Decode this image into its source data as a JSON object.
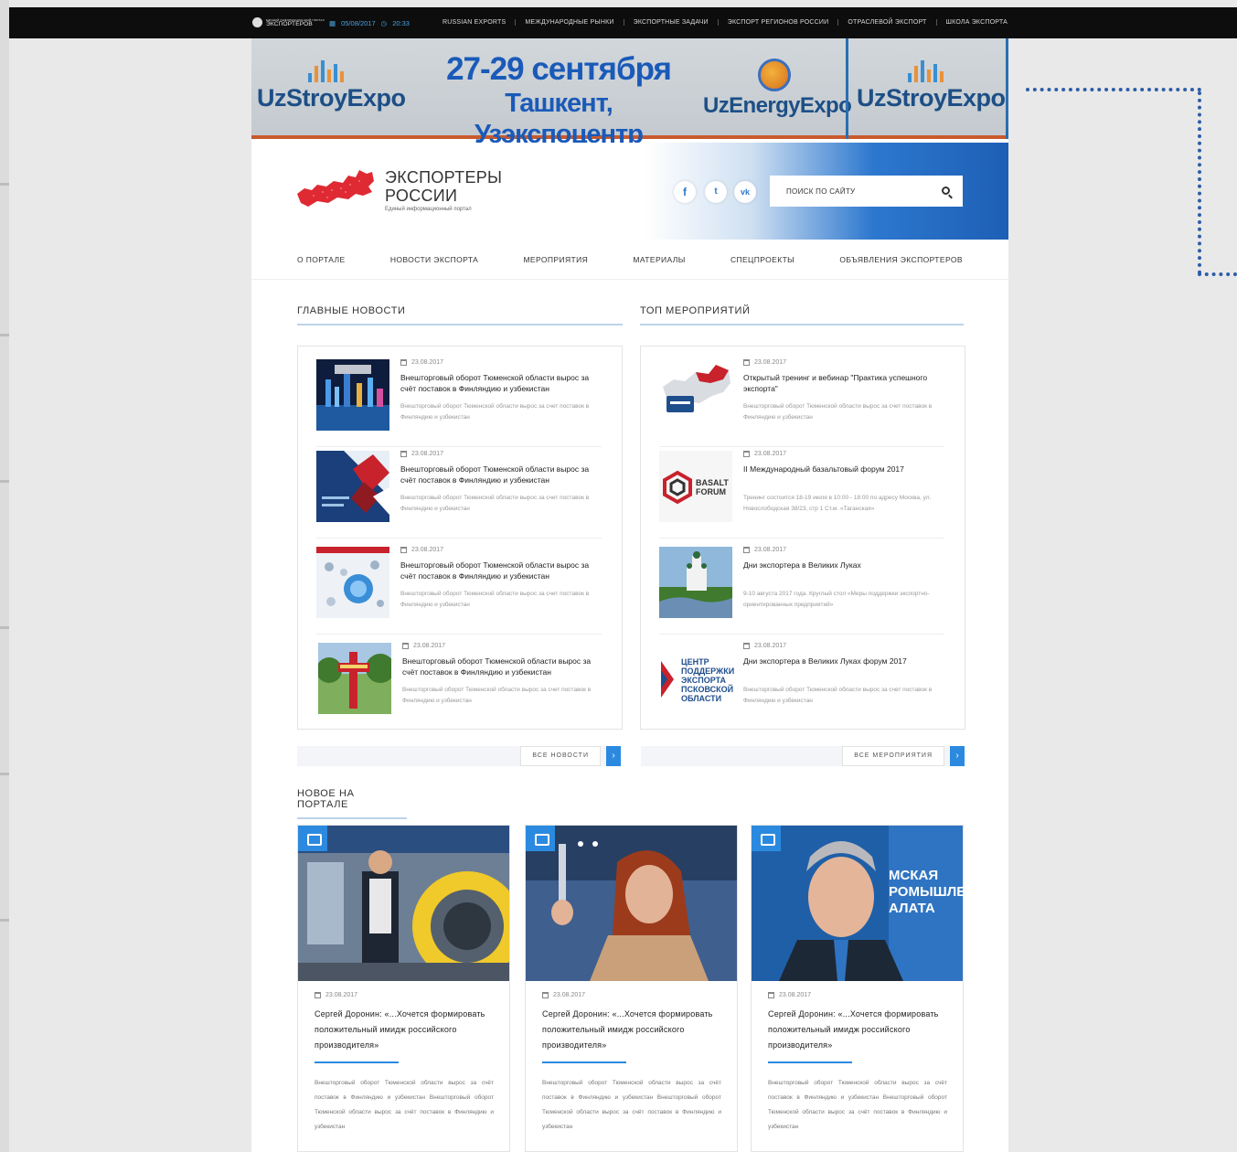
{
  "topbar": {
    "mini_logo_line1": "ЕДИНЫЙ ИНФОРМАЦИОННЫЙ ПОРТАЛ",
    "mini_logo_line2": "ЭКСПОРТЕРОВ",
    "date": "05/08/2017",
    "time": "20:33",
    "nav": [
      "RUSSIAN EXPORTS",
      "МЕЖДУНАРОДНЫЕ РЫНКИ",
      "ЭКСПОРТНЫЕ ЗАДАЧИ",
      "ЭКСПОРТ РЕГИОНОВ РОССИИ",
      "ОТРАСЛЕВОЙ ЭКСПОРТ",
      "ШКОЛА ЭКСПОРТА"
    ]
  },
  "banner": {
    "left_logo": "UzStroyExpo",
    "date_line": "27-29 сентября",
    "place_line": "Ташкент, Узэкспоцентр",
    "energy_logo": "UzEnergyExpo",
    "right_logo": "UzStroyExpo",
    "accent_color": "#1a5ab8"
  },
  "header": {
    "title_line1": "ЭКСПОРТЕРЫ",
    "title_line2": "РОССИИ",
    "subtitle": "Единый информационный портал",
    "social": [
      "f",
      "t",
      "vk"
    ],
    "search_placeholder": "ПОИСК ПО САЙТУ"
  },
  "mainnav": [
    "О ПОРТАЛЕ",
    "НОВОСТИ ЭКСПОРТА",
    "МЕРОПРИЯТИЯ",
    "МАТЕРИАЛЫ",
    "СПЕЦПРОЕКТЫ",
    "ОБЪЯВЛЕНИЯ ЭКСПОРТЕРОВ"
  ],
  "news": {
    "title": "ГЛАВНЫЕ НОВОСТИ",
    "more": "ВСЕ НОВОСТИ",
    "items": [
      {
        "date": "23.08.2017",
        "title": "Внешторговый оборот Тюменской области вырос за счёт поставок в Финляндию и узбекистан",
        "desc": "Внешторговый оборот Тюменской области вырос за счет поставок в Финляндию и узбекистан"
      },
      {
        "date": "23.08.2017",
        "title": "Внешторговый оборот Тюменской области вырос за счёт поставок в Финляндию и узбекистан",
        "desc": "Внешторговый оборот Тюменской области вырос за счет поставок в Финляндию и узбекистан"
      },
      {
        "date": "23.08.2017",
        "title": "Внешторговый оборот Тюменской области вырос за счёт поставок в Финляндию и узбекистан",
        "desc": "Внешторговый оборот Тюменской области вырос за счет поставок в Финляндию и узбекистан"
      },
      {
        "date": "23.08.2017",
        "title": "Внешторговый оборот Тюменской области вырос за счёт поставок в Финляндию и узбекистан",
        "desc": "Внешторговый оборот Тюменской области вырос за счет поставок в Финляндию и узбекистан"
      }
    ]
  },
  "events": {
    "title": "ТОП МЕРОПРИЯТИЙ",
    "more": "ВСЕ МЕРОПРИЯТИЯ",
    "items": [
      {
        "date": "23.08.2017",
        "title": "Открытый тренинг и вебинар \"Практика успешного экспорта\"",
        "desc": "Внешторговый оборот Тюменской области вырос за счет поставок в Финляндию и узбекистан"
      },
      {
        "date": "23.08.2017",
        "title": "II Международный базальтовый форум 2017",
        "desc": "Тренинг состоится 18-19 июля в 10:00 - 18:00 по адресу Москва, ул. Новослободская 38/23, стр 1 Ст.м. «Таганская»"
      },
      {
        "date": "23.08.2017",
        "title": "Дни экспортера в Великих Луках",
        "desc": "9-10 августа 2017 года. Круглый стол «Меры поддержки экспортно-ориентированных предприятий»"
      },
      {
        "date": "23.08.2017",
        "title": "Дни экспортера в Великих Лукаx форум 2017",
        "desc": "Внешторговый оборот Тюменской области вырос за счет поставок в Финляндию и узбекистан"
      }
    ],
    "basalt_label": "BASALT FORUM",
    "center_label": "ЦЕНТР ПОДДЕРЖКИ ЭКСПОРТА ПСКОВСКОЙ ОБЛАСТИ"
  },
  "portal": {
    "title": "НОВОЕ НА ПОРТАЛЕ",
    "banner_text": "МСКАЯ РОМЫШЛЕ АЛАТА",
    "cards": [
      {
        "date": "23.08.2017",
        "title": "Сергей Доронин: «...Хочется формировать положительный имидж российского производителя»",
        "desc": "Внешторговый оборот Тюменской области вырос за счёт поставок в Финляндию и узбекистан Внешторговый оборот Тюменской области вырос за счёт поставок в Финляндию и узбекистан"
      },
      {
        "date": "23.08.2017",
        "title": "Сергей Доронин: «...Хочется формировать положительный имидж российского производителя»",
        "desc": "Внешторговый оборот Тюменской области вырос за счёт поставок в Финляндию и узбекистан Внешторговый оборот Тюменской области вырос за счёт поставок в Финляндию и узбекистан"
      },
      {
        "date": "23.08.2017",
        "title": "Сергей Доронин: «...Хочется формировать положительный имидж российского производителя»",
        "desc": "Внешторговый оборот Тюменской области вырос за счёт поставок в Финляндию и узбекистан Внешторговый оборот Тюменской области вырос за счёт поставок в Финляндию и узбекистан"
      }
    ]
  }
}
